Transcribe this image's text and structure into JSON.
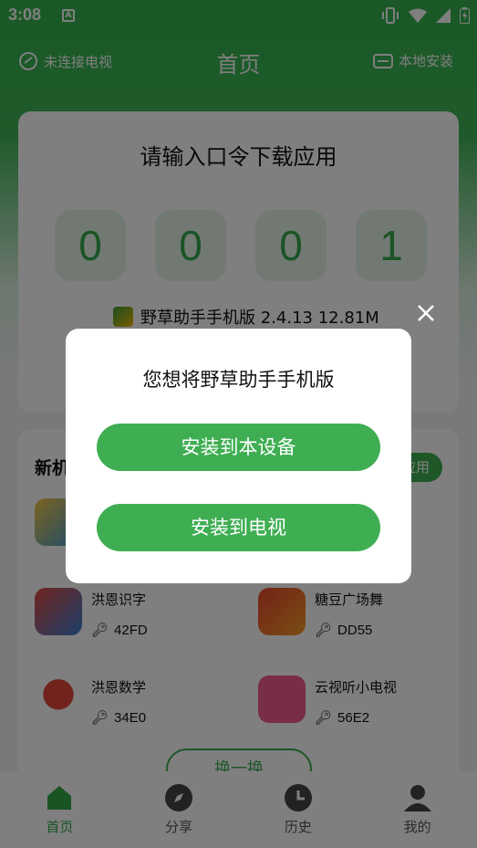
{
  "statusbar": {
    "time": "3:08",
    "notif_letter": "A"
  },
  "topnav": {
    "left_label": "未连接电视",
    "title": "首页",
    "right_label": "本地安装"
  },
  "code_card": {
    "heading": "请输入口令下载应用",
    "digits": [
      "0",
      "0",
      "0",
      "1"
    ],
    "app_info": "野草助手手机版 2.4.13 12.81M"
  },
  "list_card": {
    "section_title_visible": "新机",
    "pill_label_visible": "应用",
    "apps": [
      {
        "name": "洪恩识字",
        "code": "42FD",
        "color1": "#e04a3a",
        "color2": "#3b7ed6"
      },
      {
        "name": "糖豆广场舞",
        "code": "DD55",
        "color1": "#e8452f",
        "color2": "#f39a26"
      },
      {
        "name": "洪恩数学",
        "code": "34E0",
        "color1": "#ffffff",
        "color2": "#e4473b"
      },
      {
        "name": "云视听小电视",
        "code": "56E2",
        "color1": "#f25b8c",
        "color2": "#e23a6e"
      }
    ],
    "swap_button": "换一换"
  },
  "tabs": [
    {
      "label": "首页",
      "icon": "home-icon",
      "active": true
    },
    {
      "label": "分享",
      "icon": "compass-icon",
      "active": false
    },
    {
      "label": "历史",
      "icon": "clock-icon",
      "active": false
    },
    {
      "label": "我的",
      "icon": "user-icon",
      "active": false
    }
  ],
  "dialog": {
    "message": "您想将野草助手手机版",
    "install_device": "安装到本设备",
    "install_tv": "安装到电视"
  },
  "colors": {
    "accent": "#3fae53",
    "digit_bg": "#e5f2e7"
  }
}
